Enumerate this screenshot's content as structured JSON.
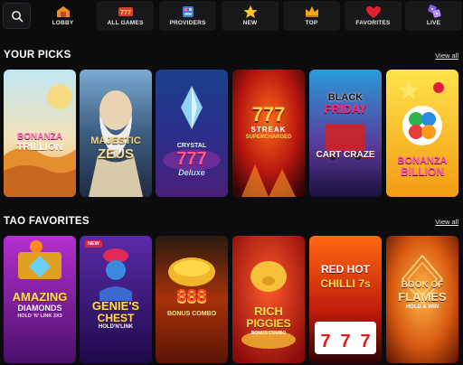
{
  "nav": {
    "items": [
      {
        "label": "LOBBY",
        "icon": "lobby-icon",
        "active": true
      },
      {
        "label": "ALL GAMES",
        "icon": "all-games-icon"
      },
      {
        "label": "PROVIDERS",
        "icon": "providers-icon"
      },
      {
        "label": "NEW",
        "icon": "star-icon"
      },
      {
        "label": "TOP",
        "icon": "crown-icon"
      },
      {
        "label": "FAVORITES",
        "icon": "heart-icon"
      },
      {
        "label": "LIVE",
        "icon": "live-icon"
      }
    ]
  },
  "sections": [
    {
      "title": "YOUR PICKS",
      "view_all": "View all",
      "games": [
        {
          "line1": "BONANZA",
          "line2": "TRILLION"
        },
        {
          "line1": "MAJESTIC",
          "line2": "ZEUS"
        },
        {
          "line1": "CRYSTAL",
          "line2": "777",
          "line3": "Deluxe"
        },
        {
          "line1": "777",
          "line2": "STREAK",
          "line3": "SUPERCHARGED"
        },
        {
          "line1": "BLACK",
          "line2": "FRIDAY",
          "line3": "CART CRAZE"
        },
        {
          "line1": "BONANZA",
          "line2": "BILLION"
        }
      ]
    },
    {
      "title": "TAO FAVORITES",
      "view_all": "View all",
      "games": [
        {
          "line1": "AMAZING",
          "line2": "DIAMONDS",
          "line3": "HOLD 'N' LINK 3X3"
        },
        {
          "line1": "GENIE'S",
          "line2": "CHEST",
          "line3": "HOLD'N'LINK",
          "badge": "NEW"
        },
        {
          "line1": "888",
          "line2": "BONUS COMBO"
        },
        {
          "line1": "RICH",
          "line2": "PIGGIES",
          "line3": "BONUS COMBO"
        },
        {
          "line1": "RED HOT",
          "line2": "CHILLI 7s"
        },
        {
          "line1": "BOOK OF",
          "line2": "FLAMES",
          "line3": "HOLD & WIN"
        }
      ]
    }
  ]
}
